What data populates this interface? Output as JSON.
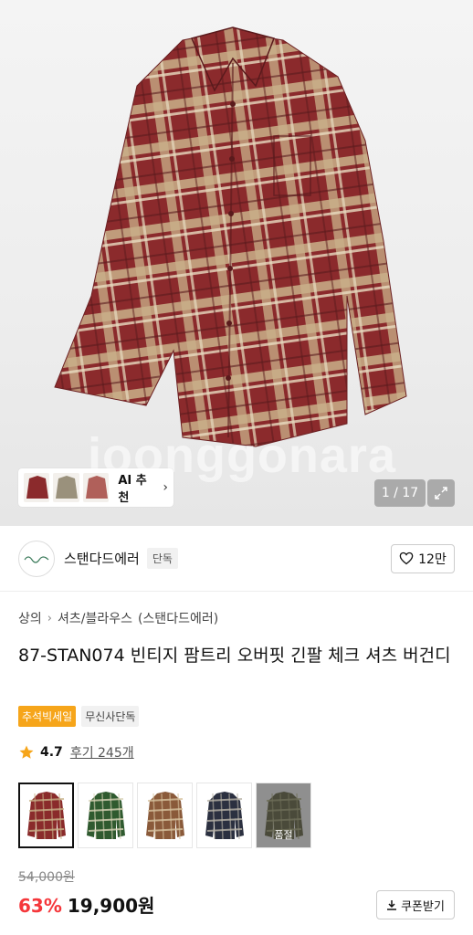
{
  "hero": {
    "watermark": "joonggonara",
    "ai_chip": {
      "label": "AI 추천",
      "chevron": "chevron-right-icon"
    },
    "counter": "1 / 17",
    "expand_icon": "expand-icon"
  },
  "brand": {
    "name": "스탠다드에러",
    "badge": "단독",
    "likes": "12만",
    "like_icon": "heart-outline-icon"
  },
  "breadcrumb": {
    "items": [
      "상의",
      "셔츠/블라우스",
      "(스탠다드에러)"
    ]
  },
  "product": {
    "title": "87-STAN074 빈티지 팜트리 오버핏 긴팔 체크 셔츠 버건디",
    "tags": [
      "추석빅세일",
      "무신사단독"
    ],
    "rating": "4.7",
    "reviews": "후기 245개"
  },
  "colors": {
    "soldout_label": "품절",
    "options": [
      {
        "color": "#8a2b2b",
        "accent": "#c9b48a",
        "selected": true,
        "soldout": false
      },
      {
        "color": "#2f5a2f",
        "accent": "#d9d4b8",
        "selected": false,
        "soldout": false
      },
      {
        "color": "#8a5a3a",
        "accent": "#d8c3a0",
        "selected": false,
        "soldout": false
      },
      {
        "color": "#2b3040",
        "accent": "#b9b4a8",
        "selected": false,
        "soldout": false
      },
      {
        "color": "#4a4a3a",
        "accent": "#6e6e58",
        "selected": false,
        "soldout": true
      }
    ]
  },
  "price": {
    "original": "54,000원",
    "discount": "63%",
    "final": "19,900원",
    "coupon_label": "쿠폰받기",
    "coupon_icon": "download-icon"
  },
  "palette": {
    "discount_red": "#f5373b",
    "tag_orange": "#f6a51a"
  }
}
